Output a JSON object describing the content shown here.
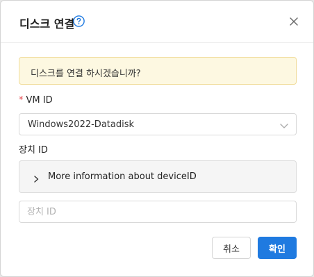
{
  "dialog": {
    "title": "디스크 연결",
    "help_icon": "question-circle-icon",
    "close_icon": "close-icon"
  },
  "alert": {
    "message": "디스크를 연결 하시겠습니까?"
  },
  "form": {
    "vm_id": {
      "required_mark": "*",
      "label": "VM ID",
      "selected_value": "Windows2022-Datadisk",
      "icon": "chevron-down-icon"
    },
    "device_id": {
      "label": "장치 ID",
      "collapse_text": "More information about deviceID",
      "collapse_icon": "chevron-right-icon",
      "placeholder": "장치 ID",
      "value": ""
    }
  },
  "footer": {
    "cancel_label": "취소",
    "ok_label": "확인"
  },
  "colors": {
    "primary": "#1f7ae0",
    "alert_bg": "#fdf8e1",
    "alert_border": "#f0dc9a",
    "required": "#e5484d"
  }
}
